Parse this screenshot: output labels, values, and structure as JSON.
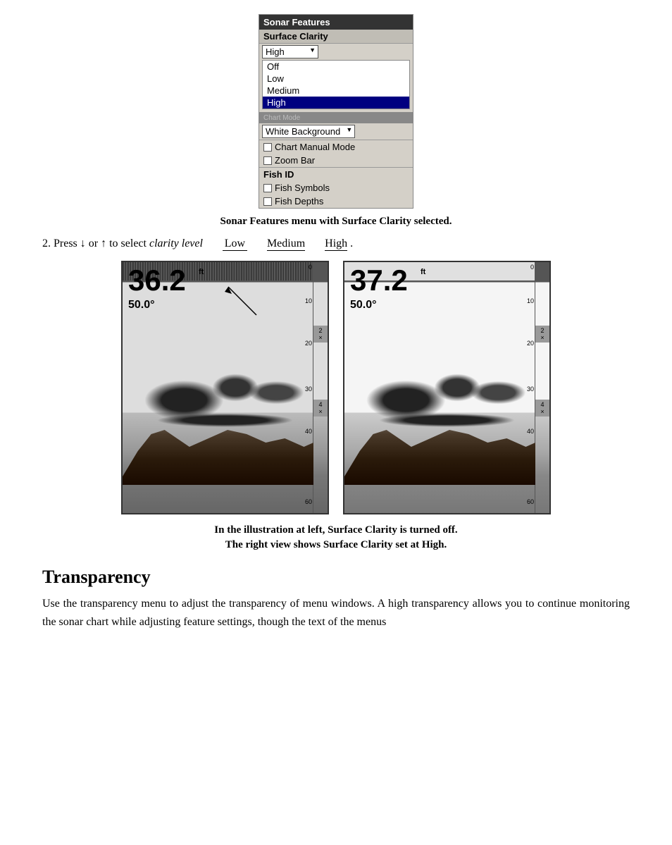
{
  "menu": {
    "title": "Sonar Features",
    "surface_clarity_label": "Surface Clarity",
    "current_value": "High",
    "options": [
      "Off",
      "Low",
      "Medium",
      "High"
    ],
    "selected_option": "High",
    "white_background": "White Background",
    "chart_manual_mode": "Chart Manual Mode",
    "zoom_bar": "Zoom Bar",
    "fish_id_label": "Fish ID",
    "fish_symbols": "Fish Symbols",
    "fish_depths": "Fish Depths"
  },
  "menu_caption": "Sonar Features menu with Surface Clarity selected.",
  "instruction": {
    "step": "2.",
    "text_before": "Press",
    "arrow_down": "↓",
    "text_or": "or",
    "arrow_up": "↑",
    "text_after": "to select",
    "italic_text": "clarity level",
    "pipe1": "|",
    "pipe2": "|",
    "pipe3": "|",
    "dot": "."
  },
  "clarity_options": {
    "low": "Low",
    "medium": "Medium",
    "high": "High"
  },
  "left_sonar": {
    "depth": "36.2",
    "ft": "ft",
    "angle": "50.0°",
    "zoom_labels": [
      "2×",
      "4×"
    ]
  },
  "right_sonar": {
    "depth": "37.2",
    "ft": "ft",
    "angle": "50.0°",
    "zoom_labels": [
      "2×",
      "4×"
    ]
  },
  "images_caption_line1": "In the illustration at left, Surface Clarity is turned off.",
  "images_caption_line2": "The right view shows Surface Clarity set at High.",
  "transparency_section": {
    "heading": "Transparency",
    "body": "Use the transparency menu to adjust the transparency of menu windows. A high transparency allows you to continue monitoring the sonar chart while adjusting feature settings, though the text of the menus"
  }
}
